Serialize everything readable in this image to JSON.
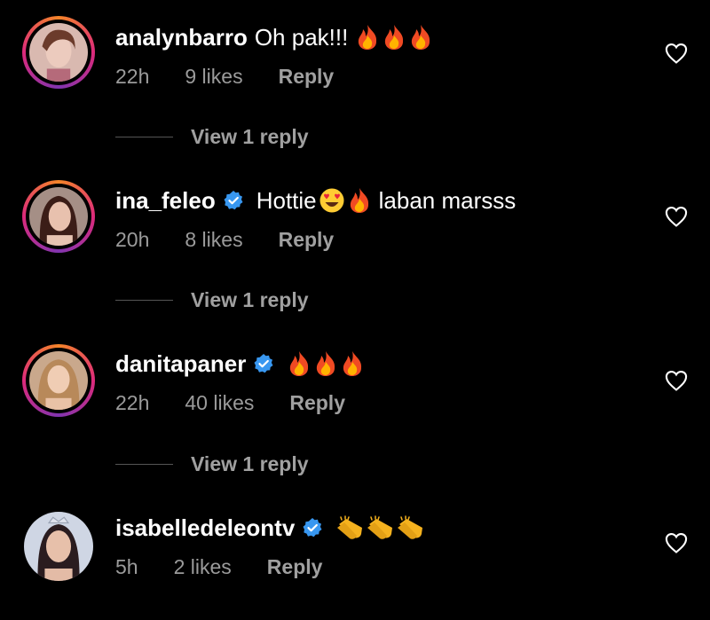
{
  "comments": [
    {
      "username": "analynbarro",
      "verified": false,
      "text": "Oh pak!!!",
      "emoji": [
        "fire",
        "fire",
        "fire"
      ],
      "time": "22h",
      "likes": "9 likes",
      "reply": "Reply",
      "view_replies": "View 1 reply"
    },
    {
      "username": "ina_feleo",
      "verified": true,
      "text": "Hottie",
      "emoji": [
        "heart-eyes",
        "fire"
      ],
      "text_after": "laban marsss",
      "time": "20h",
      "likes": "8 likes",
      "reply": "Reply",
      "view_replies": "View 1 reply"
    },
    {
      "username": "danitapaner",
      "verified": true,
      "text": "",
      "emoji": [
        "fire",
        "fire",
        "fire"
      ],
      "time": "22h",
      "likes": "40 likes",
      "reply": "Reply",
      "view_replies": "View 1 reply"
    },
    {
      "username": "isabelledeleontv",
      "verified": true,
      "text": "",
      "emoji": [
        "clap",
        "clap",
        "clap"
      ],
      "time": "5h",
      "likes": "2 likes",
      "reply": "Reply"
    }
  ],
  "colors": {
    "background": "#000000",
    "text": "#ffffff",
    "meta": "#9b9b9b",
    "verified": "#3897f0",
    "story_ring": "#dd2a7b"
  }
}
